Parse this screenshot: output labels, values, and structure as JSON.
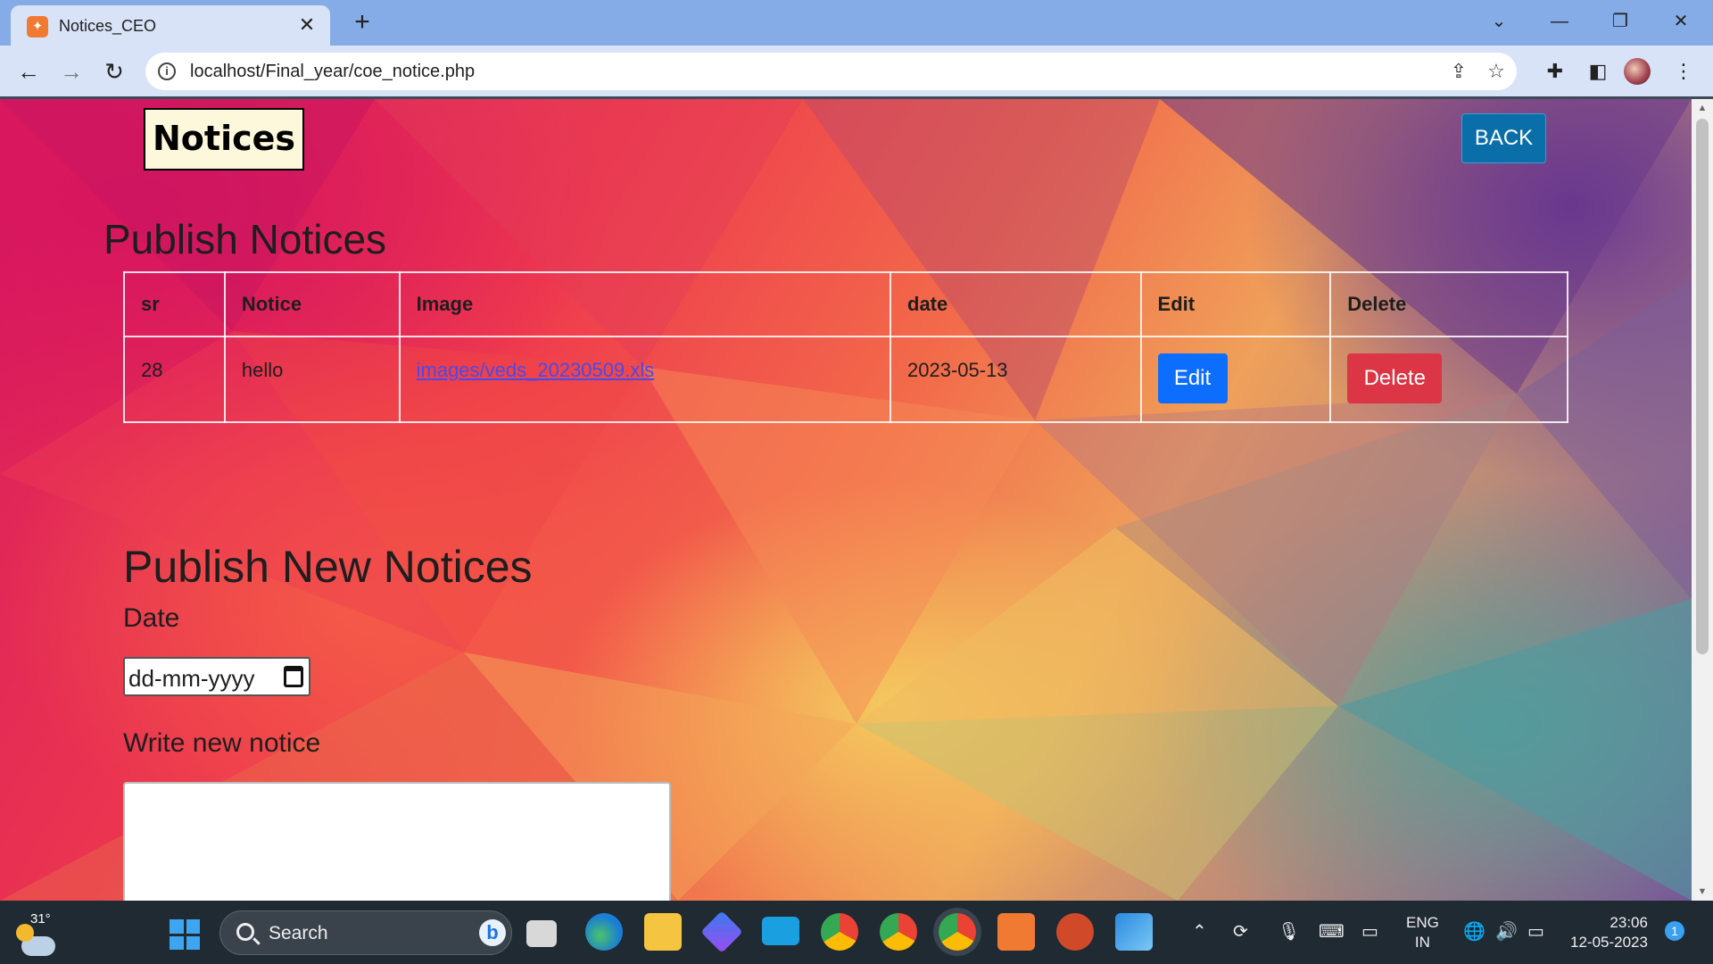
{
  "browser": {
    "tab_title": "Notices_CEO",
    "tab_favicon": "xampp-icon",
    "url": "localhost/Final_year/coe_notice.php"
  },
  "page": {
    "brand": "Notices",
    "back_label": "BACK",
    "publish_heading": "Publish Notices",
    "table": {
      "headers": [
        "sr",
        "Notice",
        "Image",
        "date",
        "Edit",
        "Delete"
      ],
      "rows": [
        {
          "sr": "28",
          "notice": "hello",
          "image": "images/veds_20230509.xls",
          "date": "2023-05-13",
          "edit_label": "Edit",
          "delete_label": "Delete"
        }
      ]
    },
    "new_heading": "Publish New Notices",
    "date_label": "Date",
    "date_placeholder": "dd-mm-yyyy",
    "notice_label": "Write new notice",
    "notice_value": ""
  },
  "taskbar": {
    "weather_temp": "31°",
    "search_placeholder": "Search",
    "lang_line1": "ENG",
    "lang_line2": "IN",
    "time": "23:06",
    "date": "12-05-2023",
    "notification_count": "1"
  },
  "colors": {
    "edit_button": "#0d6efd",
    "delete_button": "#dc3545",
    "back_button": "#0a6fa8",
    "brand_bg": "#fdf7dc"
  }
}
